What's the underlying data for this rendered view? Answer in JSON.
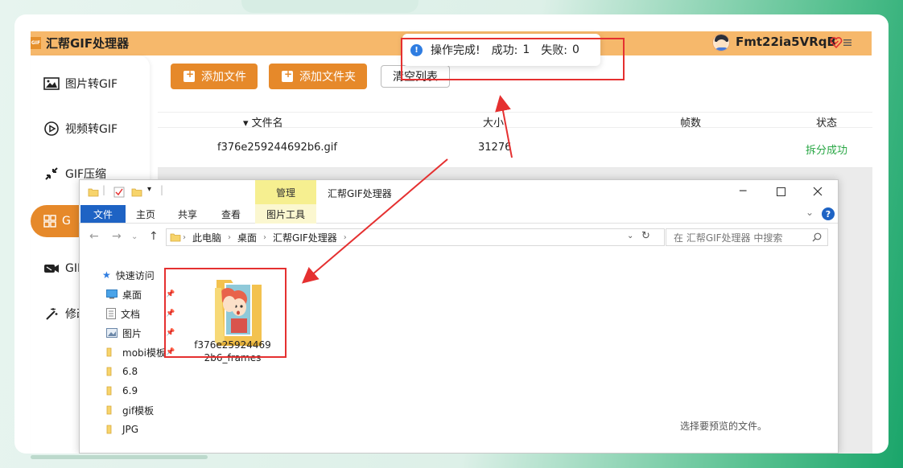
{
  "app": {
    "title": "汇帮GIF处理器",
    "logo_text": "GIF",
    "user_name": "Fmt22ia5VRqB"
  },
  "sidebar": {
    "items": [
      {
        "label": "图片转GIF",
        "icon": "image-icon"
      },
      {
        "label": "视频转GIF",
        "icon": "video-play-icon"
      },
      {
        "label": "GIF压缩",
        "icon": "compress-arrows-icon"
      },
      {
        "label": "G",
        "icon": "grid-icon",
        "active": true
      },
      {
        "label": "GIF",
        "icon": "camera-icon"
      },
      {
        "label": "修改",
        "icon": "magic-wand-icon"
      }
    ]
  },
  "toolbar": {
    "add_file": "添加文件",
    "add_folder": "添加文件夹",
    "clear_list": "清空列表"
  },
  "table": {
    "headers": {
      "name": "文件名",
      "size": "大小",
      "frames": "帧数",
      "status": "状态"
    },
    "rows": [
      {
        "name": "f376e259244692b6.gif",
        "size": "31276",
        "frames": "",
        "status": "拆分成功"
      }
    ]
  },
  "toast": {
    "message": "操作完成!",
    "success_label": "成功:",
    "success_count": "1",
    "fail_label": "失败:",
    "fail_count": "0"
  },
  "explorer": {
    "window_title": "汇帮GIF处理器",
    "manage_tab": "管理",
    "ribbon": {
      "file": "文件",
      "home": "主页",
      "share": "共享",
      "view": "查看",
      "picture_tools": "图片工具"
    },
    "breadcrumb": [
      "此电脑",
      "桌面",
      "汇帮GIF处理器"
    ],
    "search_placeholder": "在 汇帮GIF处理器 中搜索",
    "nav": {
      "quick_access": "快速访问",
      "items": [
        "桌面",
        "文档",
        "图片",
        "mobi模板",
        "6.8",
        "6.9",
        "gif模板",
        "JPG"
      ]
    },
    "folder_name": "f376e259244692b6_frames",
    "folder_name_line1": "f376e25924469",
    "folder_name_line2": "2b6_frames",
    "preview_message": "选择要预览的文件。"
  },
  "colors": {
    "header": "#f6b86b",
    "accent": "#e6892a",
    "success": "#29a745",
    "highlight": "#e53030",
    "file_tab": "#1e63c4"
  }
}
